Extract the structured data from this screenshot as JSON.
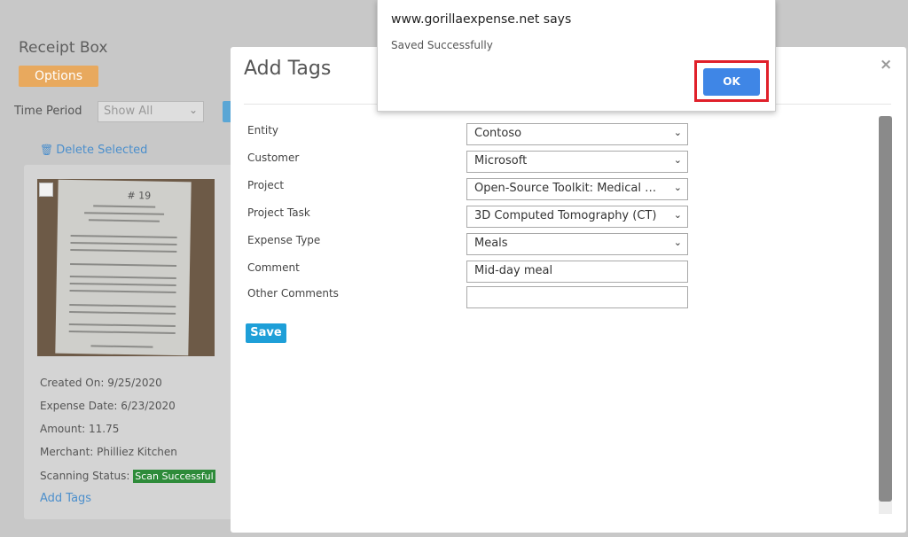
{
  "background": {
    "title": "Receipt Box",
    "options_label": "Options",
    "time_period_label": "Time Period",
    "time_period_value": "Show All",
    "delete_selected_label": "Delete Selected",
    "receipt": {
      "receipt_number": "# 19",
      "created_on": "Created On: 9/25/2020",
      "expense_date": "Expense Date: 6/23/2020",
      "amount": "Amount: 11.75",
      "merchant": "Merchant: Philliez Kitchen",
      "scanning_status_label": "Scanning Status:",
      "scanning_status_value": "Scan Successful",
      "add_tags_label": "Add Tags"
    }
  },
  "modal": {
    "title": "Add Tags",
    "close_glyph": "×",
    "fields": {
      "entity": {
        "label": "Entity",
        "value": "Contoso"
      },
      "customer": {
        "label": "Customer",
        "value": "Microsoft"
      },
      "project": {
        "label": "Project",
        "value": "Open-Source Toolkit: Medical I..."
      },
      "project_task": {
        "label": "Project Task",
        "value": "3D Computed Tomography (CT)"
      },
      "expense_type": {
        "label": "Expense Type",
        "value": "Meals"
      },
      "comment": {
        "label": "Comment",
        "value": "Mid-day meal"
      },
      "other_comments": {
        "label": "Other Comments",
        "value": ""
      }
    },
    "save_label": "Save"
  },
  "alert": {
    "title": "www.gorillaexpense.net says",
    "message": "Saved Successfully",
    "ok_label": "OK"
  },
  "icons": {
    "trash": "trash-icon",
    "chevron": "chevron-down-icon",
    "close": "close-icon"
  },
  "colors": {
    "options_button": "#e8a95e",
    "save_button": "#1e9fd8",
    "ok_button": "#3f86e6",
    "ok_highlight": "#e0202a",
    "scan_success": "#2e8b3a",
    "link": "#4c8fcc"
  }
}
